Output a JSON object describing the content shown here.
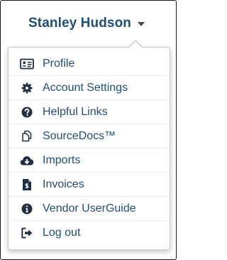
{
  "user": {
    "name": "Stanley Hudson"
  },
  "menu": {
    "items": [
      {
        "label": "Profile",
        "icon": "id-card-icon"
      },
      {
        "label": "Account Settings",
        "icon": "gear-icon"
      },
      {
        "label": "Helpful Links",
        "icon": "question-circle-icon"
      },
      {
        "label": "SourceDocs™",
        "icon": "documents-icon"
      },
      {
        "label": "Imports",
        "icon": "cloud-download-icon"
      },
      {
        "label": "Invoices",
        "icon": "invoice-icon"
      },
      {
        "label": "Vendor UserGuide",
        "icon": "info-circle-icon"
      },
      {
        "label": "Log out",
        "icon": "sign-out-icon"
      }
    ]
  },
  "colors": {
    "accent": "#1f4e79",
    "icon": "#1f2f44"
  }
}
